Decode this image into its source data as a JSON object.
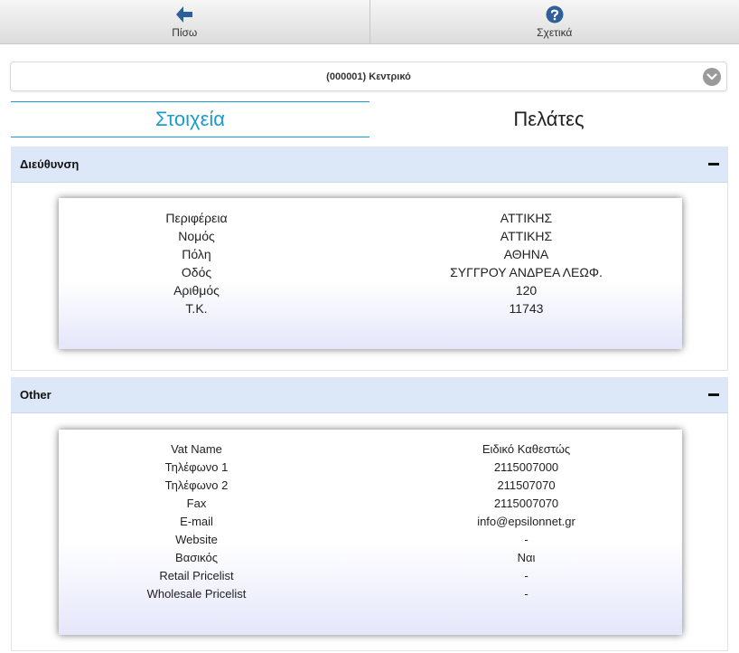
{
  "toolbar": {
    "back_label": "Πίσω",
    "about_label": "Σχετικά"
  },
  "selector": {
    "value": "(000001) Κεντρικό"
  },
  "tabs": [
    {
      "label": "Στοιχεία",
      "active": true
    },
    {
      "label": "Πελάτες",
      "active": false
    }
  ],
  "sections": {
    "address": {
      "title": "Διεύθυνση",
      "rows": [
        {
          "key": "Περιφέρεια",
          "value": "ΑΤΤΙΚΗΣ"
        },
        {
          "key": "Νομός",
          "value": "ΑΤΤΙΚΗΣ"
        },
        {
          "key": "Πόλη",
          "value": "ΑΘΗΝΑ"
        },
        {
          "key": "Οδός",
          "value": "ΣΥΓΓΡΟΥ ΑΝΔΡΕΑ ΛΕΩΦ."
        },
        {
          "key": "Αριθμός",
          "value": "120"
        },
        {
          "key": "Τ.Κ.",
          "value": "11743"
        }
      ]
    },
    "other": {
      "title": "Other",
      "rows": [
        {
          "key": "Vat Name",
          "value": "Ειδικό Καθεστώς"
        },
        {
          "key": "Τηλέφωνο 1",
          "value": "2115007000"
        },
        {
          "key": "Τηλέφωνο 2",
          "value": "211507070"
        },
        {
          "key": "Fax",
          "value": "2115007070"
        },
        {
          "key": "E-mail",
          "value": "info@epsilonnet.gr"
        },
        {
          "key": "Website",
          "value": "-"
        },
        {
          "key": "Βασικός",
          "value": "Ναι"
        },
        {
          "key": "Retail Pricelist",
          "value": "-"
        },
        {
          "key": "Wholesale Pricelist",
          "value": "-"
        }
      ]
    }
  },
  "colors": {
    "accent": "#1a9bcf",
    "icon_blue": "#2f5f9a",
    "section_header": "#dce8f8"
  },
  "icons": {
    "back": "arrow-left-icon",
    "about": "question-circle-icon",
    "dropdown": "chevron-down-icon",
    "collapse": "minus-icon"
  }
}
